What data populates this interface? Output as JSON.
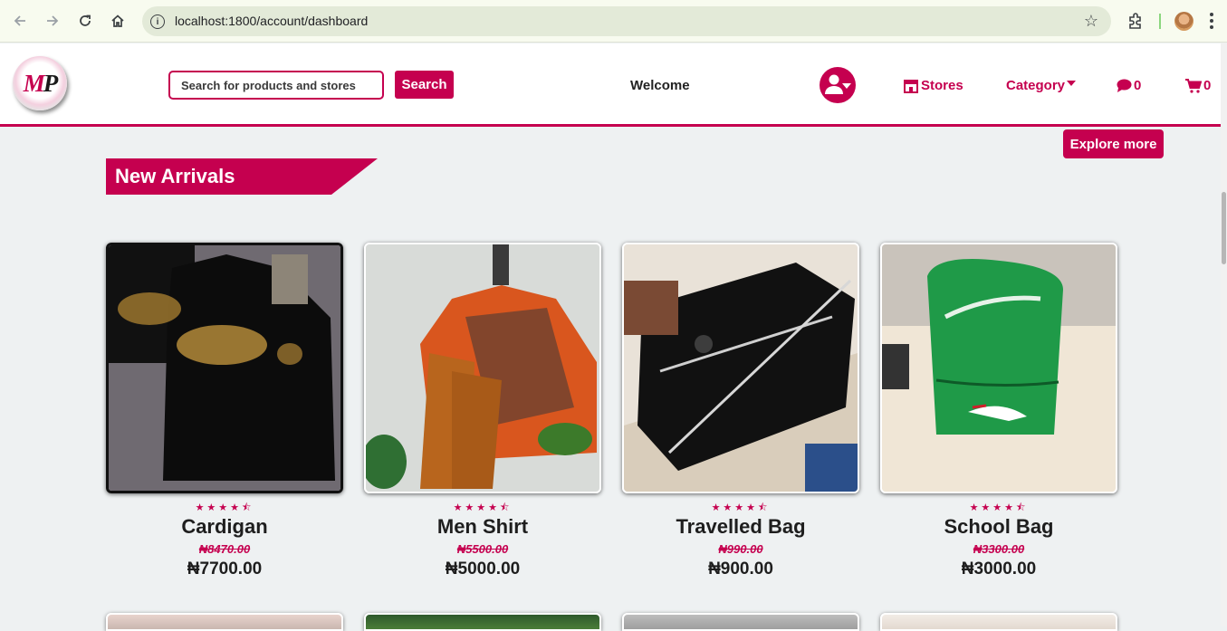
{
  "browser": {
    "url": "localhost:1800/account/dashboard"
  },
  "header": {
    "logo_text_m": "M",
    "logo_text_p": "P",
    "search_placeholder": "Search for products and stores",
    "search_button": "Search",
    "welcome": "Welcome",
    "stores": "Stores",
    "category": "Category",
    "messages_count": "0",
    "cart_count": "0"
  },
  "main": {
    "explore_button": "Explore more",
    "section_title": "New Arrivals",
    "products": [
      {
        "name": "Cardigan",
        "old_price": "₦8470.00",
        "price": "₦7700.00",
        "rating": 4.5,
        "stars": "★★★★⯪"
      },
      {
        "name": "Men Shirt",
        "old_price": "₦5500.00",
        "price": "₦5000.00",
        "rating": 4.5,
        "stars": "★★★★⯪"
      },
      {
        "name": "Travelled Bag",
        "old_price": "₦990.00",
        "price": "₦900.00",
        "rating": 4.5,
        "stars": "★★★★⯪"
      },
      {
        "name": "School Bag",
        "old_price": "₦3300.00",
        "price": "₦3000.00",
        "rating": 4.5,
        "stars": "★★★★⯪"
      }
    ]
  },
  "colors": {
    "brand": "#c5004f",
    "background": "#eef1f2"
  },
  "icons": [
    "back-icon",
    "forward-icon",
    "reload-icon",
    "home-icon",
    "site-info-icon",
    "bookmark-star-icon",
    "extensions-icon",
    "profile-avatar",
    "menu-kebab-icon",
    "user-menu-icon",
    "store-icon",
    "caret-down-icon",
    "chat-icon",
    "cart-icon"
  ]
}
